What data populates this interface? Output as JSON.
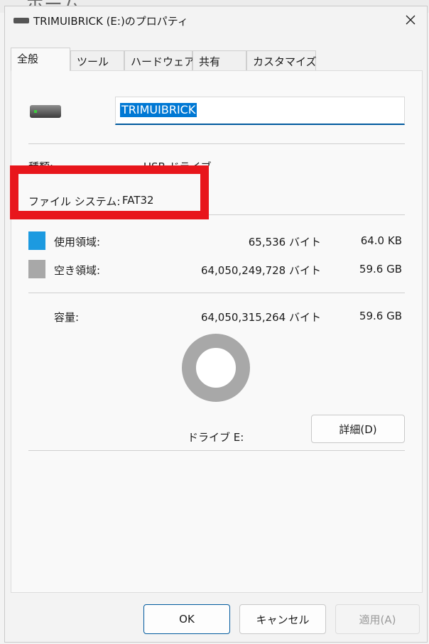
{
  "background_app": {
    "partial_text": "ホーム"
  },
  "window": {
    "title": "TRIMUIBRICK (E:)のプロパティ"
  },
  "tabs": [
    {
      "label": "全般",
      "active": true
    },
    {
      "label": "ツール",
      "active": false
    },
    {
      "label": "ハードウェア",
      "active": false
    },
    {
      "label": "共有",
      "active": false
    },
    {
      "label": "カスタマイズ",
      "active": false
    }
  ],
  "general": {
    "volume_name": "TRIMUIBRICK",
    "type_label": "種類:",
    "type_value": "USB ドライブ",
    "filesystem_label": "ファイル システム:",
    "filesystem_value": "FAT32",
    "used": {
      "label": "使用領域:",
      "bytes": "65,536 バイト",
      "size": "64.0 KB",
      "color": "#1c9ae0"
    },
    "free": {
      "label": "空き領域:",
      "bytes": "64,050,249,728 バイト",
      "size": "59.6 GB",
      "color": "#a8a8a8"
    },
    "capacity": {
      "label": "容量:",
      "bytes": "64,050,315,264 バイト",
      "size": "59.6 GB"
    },
    "drive_label": "ドライブ E:",
    "details_button": "詳細(D)"
  },
  "buttons": {
    "ok": "OK",
    "cancel": "キャンセル",
    "apply": "適用(A)"
  },
  "annotation": {
    "color": "#e8161c"
  }
}
